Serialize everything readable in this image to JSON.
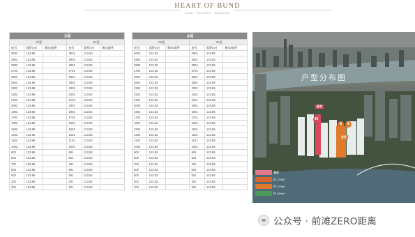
{
  "brand": {
    "title": "HEART OF BUND",
    "subtitle": "BUND · HUANGPU · SHANGHAI"
  },
  "tables": [
    {
      "building": "5号",
      "groups": [
        "02室",
        "01室"
      ],
      "columns": [
        "房号",
        "面积(㎡)",
        "景向/顺序",
        "房号",
        "面积(㎡)",
        "景向顺序"
      ],
      "rows": [
        [
          "3002",
          "123.85",
          "",
          "3001",
          "123.52",
          ""
        ],
        [
          "2902",
          "123.85",
          "",
          "2901",
          "123.52",
          ""
        ],
        [
          "2802",
          "123.85",
          "",
          "2801",
          "123.52",
          ""
        ],
        [
          "2702",
          "123.85",
          "",
          "2701",
          "123.52",
          ""
        ],
        [
          "2602",
          "123.85",
          "",
          "2601",
          "123.52",
          ""
        ],
        [
          "2502",
          "123.85",
          "",
          "2501",
          "123.52",
          ""
        ],
        [
          "2302",
          "123.85",
          "",
          "2301",
          "123.52",
          ""
        ],
        [
          "2202",
          "123.85",
          "",
          "2201",
          "123.52",
          ""
        ],
        [
          "2102",
          "123.85",
          "",
          "2101",
          "123.52",
          ""
        ],
        [
          "2002",
          "123.85",
          "",
          "2001",
          "123.52",
          ""
        ],
        [
          "1902",
          "123.85",
          "",
          "1901",
          "123.52",
          ""
        ],
        [
          "1702",
          "123.85",
          "",
          "1701",
          "123.52",
          ""
        ],
        [
          "1602",
          "123.85",
          "",
          "1601",
          "123.52",
          ""
        ],
        [
          "1502",
          "123.85",
          "",
          "1501",
          "123.52",
          ""
        ],
        [
          "1202",
          "123.85",
          "",
          "1201",
          "123.52",
          ""
        ],
        [
          "1102",
          "123.85",
          "",
          "1101",
          "123.52",
          ""
        ],
        [
          "1002",
          "123.85",
          "",
          "1001",
          "123.52",
          ""
        ],
        [
          "902",
          "123.85",
          "",
          "901",
          "123.52",
          ""
        ],
        [
          "802",
          "123.85",
          "",
          "801",
          "123.52",
          ""
        ],
        [
          "702",
          "123.85",
          "",
          "701",
          "123.52",
          ""
        ],
        [
          "602",
          "123.85",
          "",
          "601",
          "123.52",
          ""
        ],
        [
          "502",
          "123.85",
          "",
          "501",
          "123.52",
          ""
        ],
        [
          "302",
          "123.85",
          "",
          "301",
          "123.52",
          ""
        ],
        [
          "202",
          "123.85",
          "",
          "201",
          "123.52",
          ""
        ]
      ]
    },
    {
      "building": "6号",
      "groups": [
        "02室",
        "01室"
      ],
      "columns": [
        "房号",
        "面积(㎡)",
        "景向/顺序",
        "房号",
        "面积(㎡)",
        "景向/顺序"
      ],
      "rows": [
        [
          "3002",
          "123.52",
          "",
          "3001",
          "123.85",
          ""
        ],
        [
          "2902",
          "123.52",
          "",
          "2901",
          "123.85",
          ""
        ],
        [
          "2802",
          "123.52",
          "",
          "2801",
          "123.85",
          ""
        ],
        [
          "2702",
          "123.52",
          "",
          "2701",
          "123.85",
          ""
        ],
        [
          "2602",
          "123.52",
          "",
          "2601",
          "123.85",
          ""
        ],
        [
          "2502",
          "123.52",
          "",
          "2501",
          "123.85",
          ""
        ],
        [
          "2302",
          "123.52",
          "",
          "2301",
          "123.85",
          ""
        ],
        [
          "2202",
          "123.52",
          "",
          "2201",
          "123.85",
          ""
        ],
        [
          "2102",
          "123.52",
          "",
          "2101",
          "123.85",
          ""
        ],
        [
          "2002",
          "123.52",
          "",
          "2001",
          "123.85",
          ""
        ],
        [
          "1902",
          "123.52",
          "",
          "1901",
          "123.85",
          ""
        ],
        [
          "1702",
          "123.52",
          "",
          "1701",
          "123.85",
          ""
        ],
        [
          "1602",
          "123.52",
          "",
          "1601",
          "123.85",
          ""
        ],
        [
          "1502",
          "123.52",
          "",
          "1501",
          "123.85",
          ""
        ],
        [
          "1202",
          "123.52",
          "",
          "1201",
          "123.85",
          ""
        ],
        [
          "1102",
          "123.52",
          "",
          "1101",
          "123.85",
          ""
        ],
        [
          "1002",
          "123.52",
          "",
          "1001",
          "123.85",
          ""
        ],
        [
          "902",
          "123.52",
          "",
          "901",
          "123.85",
          ""
        ],
        [
          "802",
          "123.52",
          "",
          "801",
          "123.85",
          ""
        ],
        [
          "702",
          "123.52",
          "",
          "701",
          "123.85",
          ""
        ],
        [
          "602",
          "123.52",
          "",
          "601",
          "123.85",
          ""
        ],
        [
          "502",
          "123.52",
          "",
          "501",
          "123.85",
          ""
        ],
        [
          "302",
          "123.52",
          "",
          "301",
          "123.85",
          ""
        ],
        [
          "202",
          "123.52",
          "",
          "201",
          "123.85",
          ""
        ]
      ]
    }
  ],
  "photo": {
    "title": "户型分布图",
    "badges": [
      "19",
      "5",
      "6"
    ],
    "tags": [
      "叠墅",
      "叠墅"
    ],
    "legend": [
      {
        "label": "叠墅",
        "color": "#e07a8a"
      },
      {
        "label": "约 123㎡",
        "color": "#d9652e"
      },
      {
        "label": "约 123m²",
        "color": "#e0782c"
      },
      {
        "label": "约 245m²",
        "color": "#4f9a5a"
      }
    ]
  },
  "watermark": {
    "icon": "wechat-icon",
    "text": "公众号 · 前滩ZERO距离"
  },
  "colors": {
    "header": "#8a8a8a",
    "subheader": "#ededed",
    "border": "#d6d6d6"
  }
}
